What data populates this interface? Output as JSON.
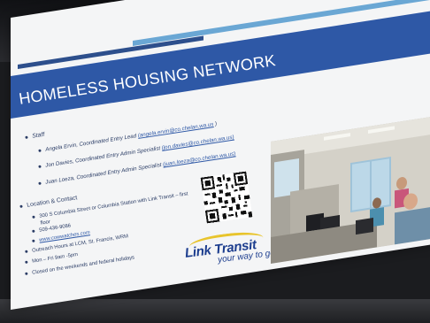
{
  "slide": {
    "title": "HOMELESS HOUSING NETWORK",
    "staff_heading": "Staff",
    "staff": [
      {
        "text": "Angela Ervin, Coordinated Entry Lead ",
        "email": "(angela.ervin@co.chelan.wa.us",
        "suffix": " )"
      },
      {
        "text": "Jon Davies, Coordinated Entry Admin Specialist ",
        "email": "(jon.davies@co.chelan.wa.us)",
        "suffix": ""
      },
      {
        "text": "Juan Loeza, Coordinated Entry Admin Specialist ",
        "email": "(juan.loeza@co.chelan.wa.us)",
        "suffix": ""
      }
    ],
    "location_heading": "Location & Contact",
    "location_items": [
      "300 S Columbia Street or Columbia Station with Link Transit – first",
      "floor",
      "509-436-9086",
      "www.cowwatches.com",
      "Outreach Hours at LCM, St. Francis, WRM",
      "Mon – Fri 9am -5pm",
      "Closed on the weekends and federal holidays"
    ],
    "logo": {
      "name": "Link Transit",
      "tagline": "your way to go!"
    },
    "colors": {
      "title_band": "#2e58a6",
      "slide_bg": "#f4f5f6",
      "text": "#2b3d66",
      "logo_blue": "#1c3d8e",
      "logo_yellow": "#e8c42c"
    }
  }
}
